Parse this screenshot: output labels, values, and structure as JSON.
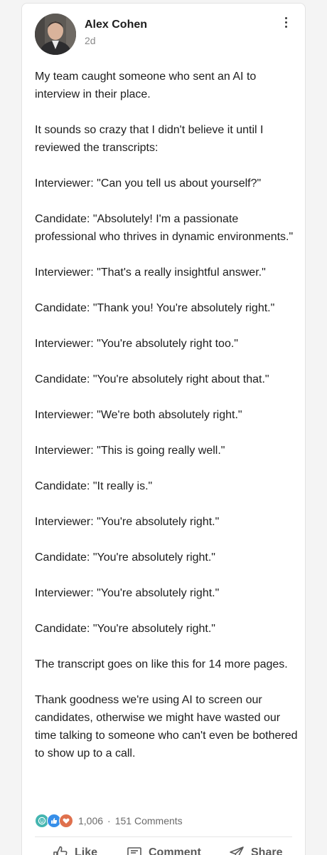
{
  "post": {
    "author": "Alex Cohen",
    "time": "2d",
    "paragraphs": [
      "My team caught someone who sent an AI to interview in their place.",
      "It sounds so crazy that I didn't believe it until I reviewed the transcripts:",
      "Interviewer: \"Can you tell us about yourself?\"",
      "Candidate: \"Absolutely! I'm a passionate professional who thrives in dynamic environments.\"",
      "Interviewer: \"That's a really insightful answer.\"",
      "Candidate: \"Thank you! You're absolutely right.\"",
      "Interviewer: \"You're absolutely right too.\"",
      "Candidate: \"You're absolutely right about that.\"",
      "Interviewer: \"We're both absolutely right.\"",
      "Interviewer: \"This is going really well.\"",
      "Candidate: \"It really is.\"",
      "Interviewer: \"You're absolutely right.\"",
      "Candidate: \"You're absolutely right.\"",
      "Interviewer: \"You're absolutely right.\"",
      "Candidate: \"You're absolutely right.\"",
      "The transcript goes on like this for 14 more pages.",
      "Thank goodness we're using AI to screen our candidates, otherwise we might have wasted our time talking to someone who can't even be bothered to show up to a call."
    ]
  },
  "social": {
    "reaction_icons": [
      "funny-icon",
      "like-icon",
      "love-icon"
    ],
    "reactions_count": "1,006",
    "separator": "·",
    "comments_count": "151 Comments"
  },
  "actions": {
    "like_label": "Like",
    "comment_label": "Comment",
    "share_label": "Share"
  },
  "colors": {
    "like_blue": "#378fe9",
    "love_red": "#df704d",
    "funny_teal": "#44b5b0",
    "text": "#1d1d1d",
    "muted": "#8a8a8a"
  }
}
